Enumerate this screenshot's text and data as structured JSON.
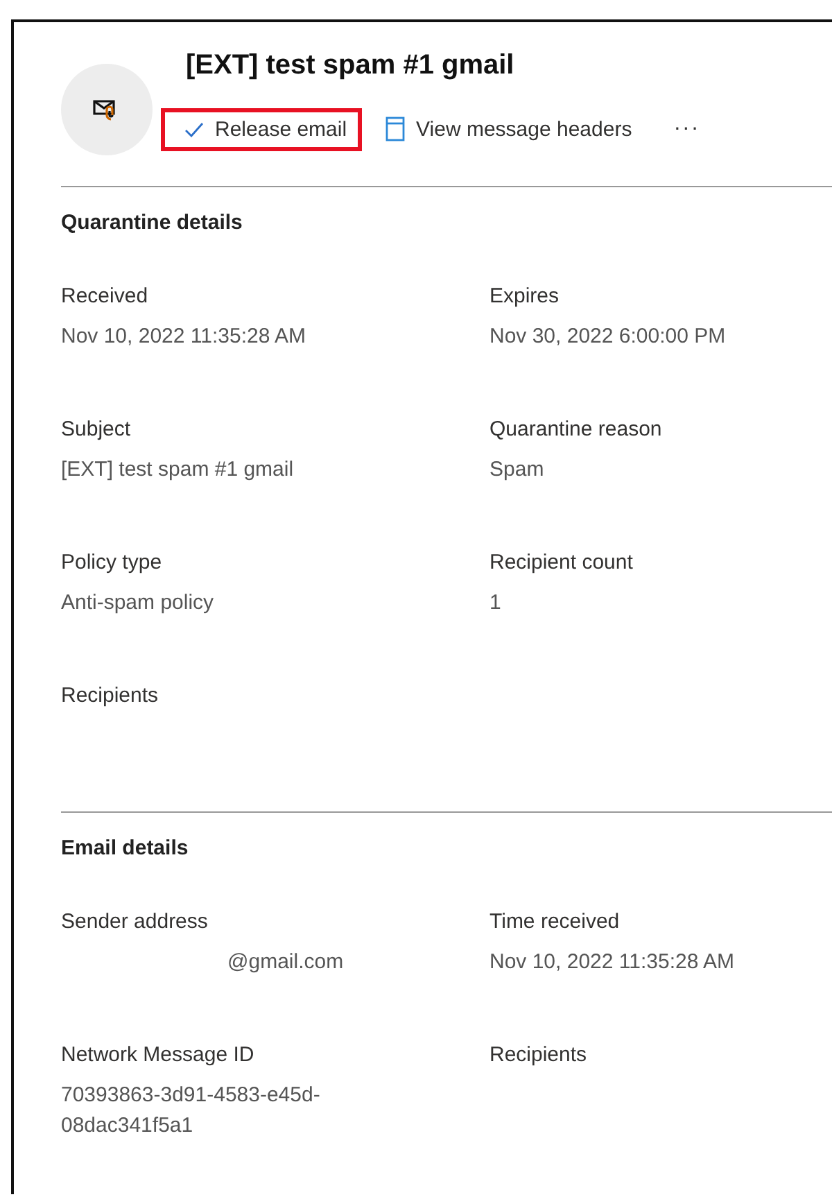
{
  "header": {
    "title": "[EXT] test spam #1 gmail"
  },
  "actions": [
    {
      "kind": "check",
      "label": "Release email",
      "highlighted": true
    },
    {
      "kind": "page",
      "label": "View message headers",
      "highlighted": false
    },
    {
      "kind": "more",
      "label": "···",
      "highlighted": false
    }
  ],
  "sections": [
    {
      "title": "Quarantine details",
      "fields": [
        {
          "label": "Received",
          "value": "Nov 10, 2022 11:35:28 AM"
        },
        {
          "label": "Expires",
          "value": "Nov 30, 2022 6:00:00 PM"
        },
        {
          "label": "Subject",
          "value": "[EXT] test spam #1 gmail"
        },
        {
          "label": "Quarantine reason",
          "value": "Spam"
        },
        {
          "label": "Policy type",
          "value": "Anti-spam policy"
        },
        {
          "label": "Recipient count",
          "value": "1"
        },
        {
          "label": "Recipients"
        }
      ]
    },
    {
      "title": "Email details",
      "fields": [
        {
          "label": "Sender address",
          "value": "@gmail.com",
          "redacted_prefix": true
        },
        {
          "label": "Time received",
          "value": "Nov 10, 2022 11:35:28 AM"
        },
        {
          "label": "Network Message ID",
          "value": "70393863-3d91-4583-e45d-08dac341f5a1"
        },
        {
          "label": "Recipients"
        }
      ]
    }
  ]
}
